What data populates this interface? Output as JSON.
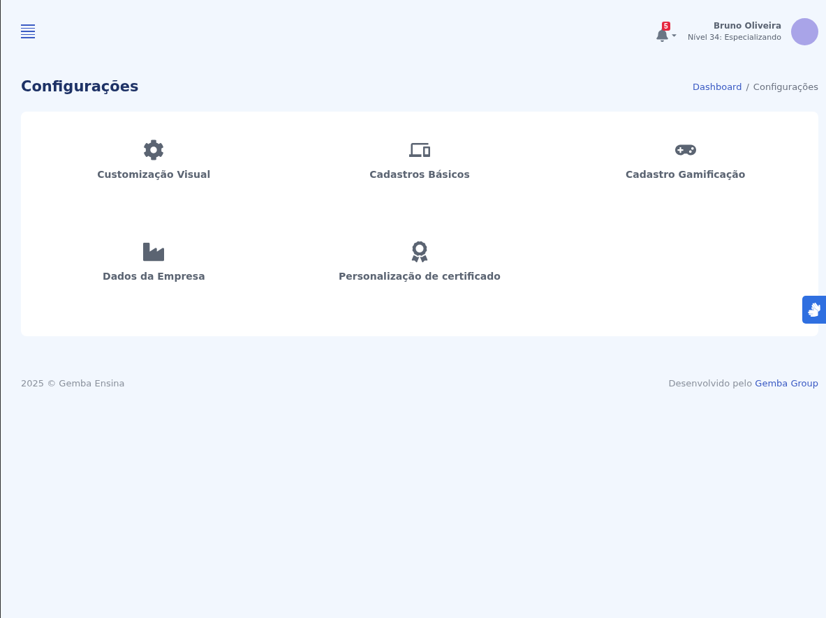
{
  "header": {
    "notifications": {
      "count": "5"
    },
    "user": {
      "name": "Bruno Oliveira",
      "level": "Nível 34: Especializando"
    }
  },
  "page": {
    "title": "Configurações",
    "breadcrumb_separator": "/",
    "breadcrumb": [
      {
        "label": "Dashboard",
        "link": true
      },
      {
        "label": "Configurações",
        "link": false
      }
    ]
  },
  "settings": [
    {
      "label": "Customização Visual"
    },
    {
      "label": "Cadastros Básicos"
    },
    {
      "label": "Cadastro Gamificação"
    },
    {
      "label": "Dados da Empresa"
    },
    {
      "label": "Personalização de certificado"
    }
  ],
  "footer": {
    "copyright": "2025 © Gemba Ensina",
    "credit": "Desenvolvido pelo",
    "credit_link": "Gemba Group"
  }
}
